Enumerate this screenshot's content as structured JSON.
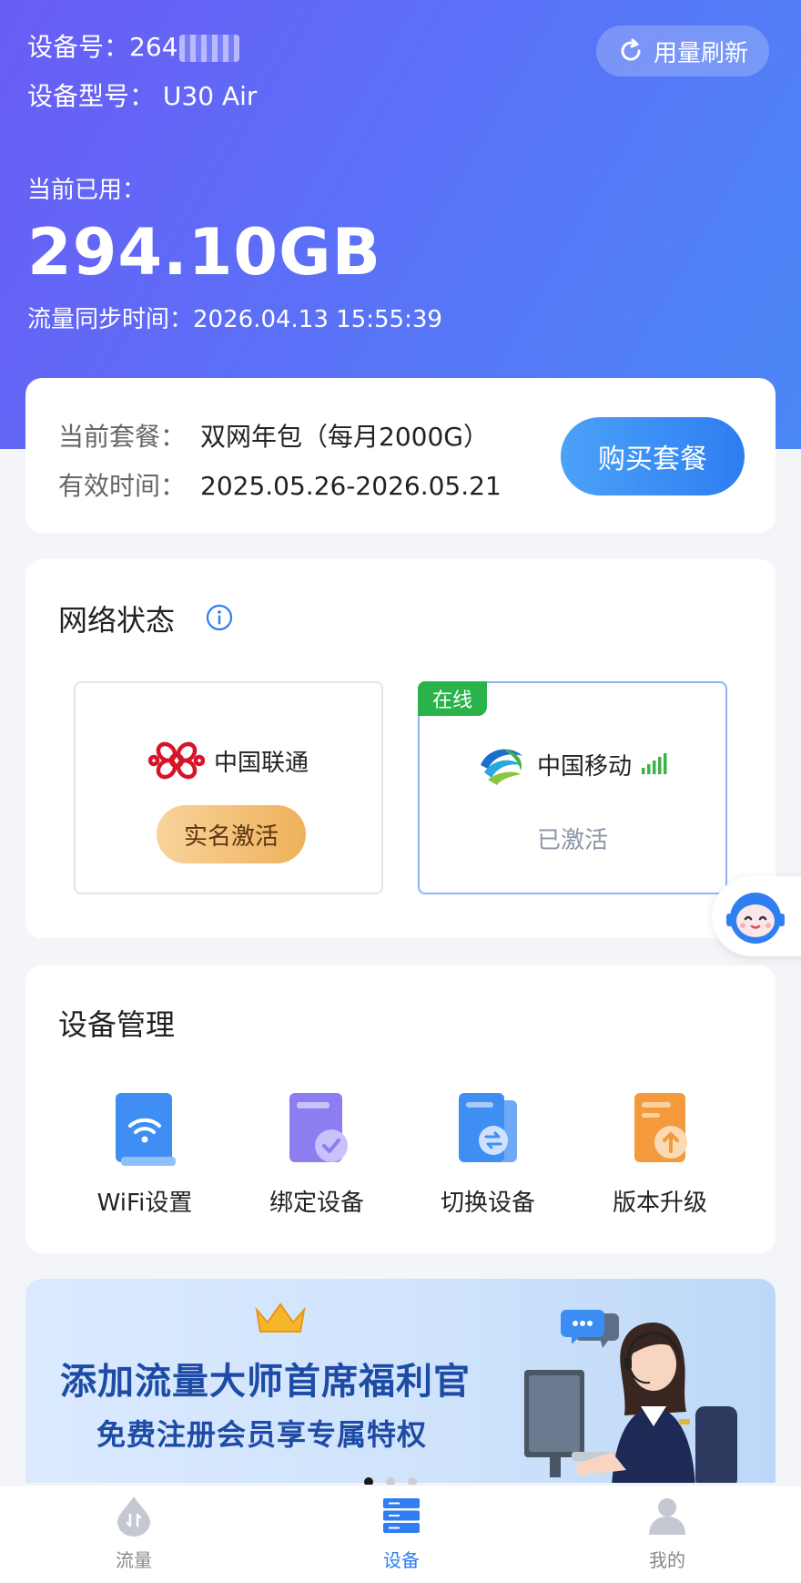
{
  "header": {
    "device_id_label": "设备号：",
    "device_id_value": "264",
    "device_model_label": "设备型号：",
    "device_model_value": "U30 Air",
    "refresh_label": "用量刷新",
    "used_label": "当前已用：",
    "used_value": "294.10GB",
    "sync_time_label": "流量同步时间：",
    "sync_time_value": "2026.04.13 15:55:39"
  },
  "plan": {
    "current_label": "当前套餐：",
    "current_value": "双网年包（每月2000G）",
    "valid_label": "有效时间：",
    "valid_value": "2025.05.26-2026.05.21",
    "buy_label": "购买套餐"
  },
  "network": {
    "title": "网络状态",
    "operators": [
      {
        "name": "中国联通",
        "action_label": "实名激活"
      },
      {
        "name": "中国移动",
        "status_label": "已激活",
        "badge": "在线"
      }
    ]
  },
  "device_mgmt": {
    "title": "设备管理",
    "items": [
      {
        "label": "WiFi设置",
        "icon": "wifi-settings-icon"
      },
      {
        "label": "绑定设备",
        "icon": "bind-device-icon"
      },
      {
        "label": "切换设备",
        "icon": "switch-device-icon"
      },
      {
        "label": "版本升级",
        "icon": "version-upgrade-icon"
      }
    ]
  },
  "banner": {
    "line1": "添加流量大师首席福利官",
    "line2": "免费注册会员享专属特权"
  },
  "tabs": [
    {
      "label": "流量",
      "active": false
    },
    {
      "label": "设备",
      "active": true
    },
    {
      "label": "我的",
      "active": false
    }
  ],
  "colors": {
    "header_gradient_start": "#6a5cf6",
    "header_gradient_end": "#4a88f6",
    "accent": "#2f7ef2",
    "online_green": "#29b34a"
  }
}
